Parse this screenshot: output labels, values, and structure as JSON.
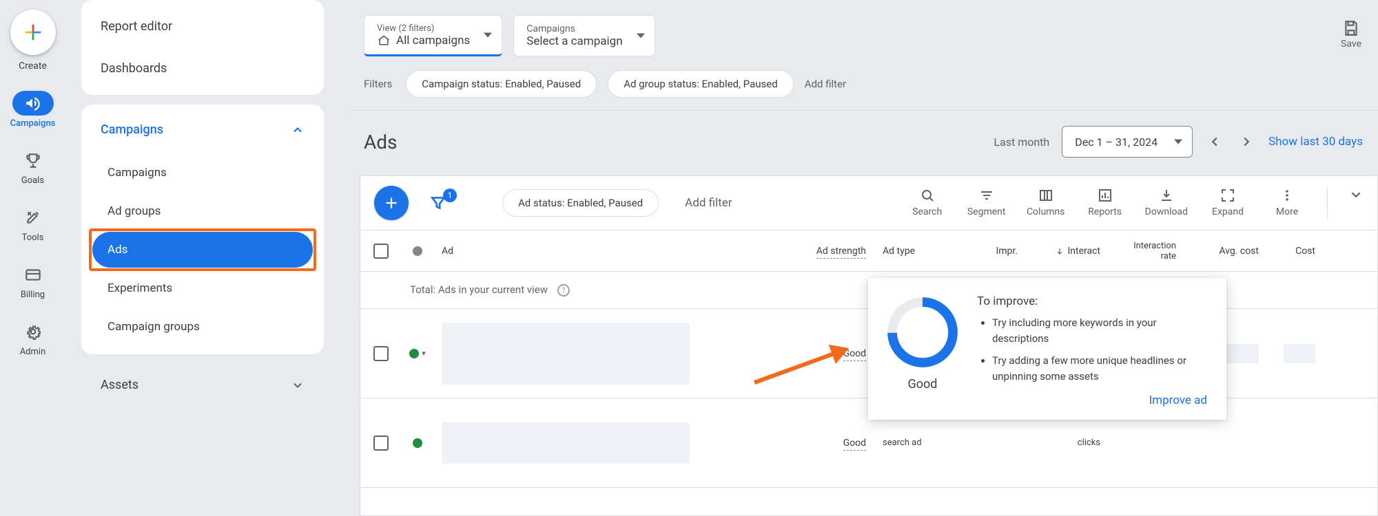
{
  "rail": {
    "create": "Create",
    "items": [
      {
        "label": "Campaigns"
      },
      {
        "label": "Goals"
      },
      {
        "label": "Tools"
      },
      {
        "label": "Billing"
      },
      {
        "label": "Admin"
      }
    ]
  },
  "side": {
    "group1": [
      "Report editor",
      "Dashboards"
    ],
    "campaigns_header": "Campaigns",
    "campaigns_items": [
      "Campaigns",
      "Ad groups",
      "Ads",
      "Experiments",
      "Campaign groups"
    ],
    "assets": "Assets"
  },
  "top": {
    "view": {
      "small": "View (2 filters)",
      "big": "All campaigns"
    },
    "camp": {
      "small": "Campaigns",
      "big": "Select a campaign"
    },
    "save": "Save"
  },
  "filters": {
    "label": "Filters",
    "chips": [
      "Campaign status: Enabled, Paused",
      "Ad group status: Enabled, Paused"
    ],
    "add": "Add filter"
  },
  "page": {
    "title": "Ads",
    "last": "Last month",
    "range": "Dec 1 – 31, 2024",
    "show30": "Show last 30 days"
  },
  "toolbar": {
    "status_pill": "Ad status: Enabled, Paused",
    "add_filter": "Add filter",
    "filter_badge": "1",
    "actions": [
      "Search",
      "Segment",
      "Columns",
      "Reports",
      "Download",
      "Expand",
      "More"
    ]
  },
  "table": {
    "headers": {
      "ad": "Ad",
      "strength": "Ad strength",
      "type": "Ad type",
      "impr": "Impr.",
      "interact": "Interact",
      "irate_l1": "Interaction",
      "irate_l2": "rate",
      "avgcost": "Avg. cost",
      "cost": "Cost"
    },
    "total_label": "Total: Ads in your current view",
    "rows": [
      {
        "status": "green",
        "strength": "Good",
        "type_visible": false
      },
      {
        "status": "green",
        "strength": "Good",
        "type_l2": "search ad",
        "interact_sub": "clicks"
      }
    ]
  },
  "popover": {
    "title": "To improve:",
    "items": [
      "Try including more keywords in your descriptions",
      "Try adding a few more unique headlines or unpinning some assets"
    ],
    "rating": "Good",
    "action": "Improve ad"
  }
}
